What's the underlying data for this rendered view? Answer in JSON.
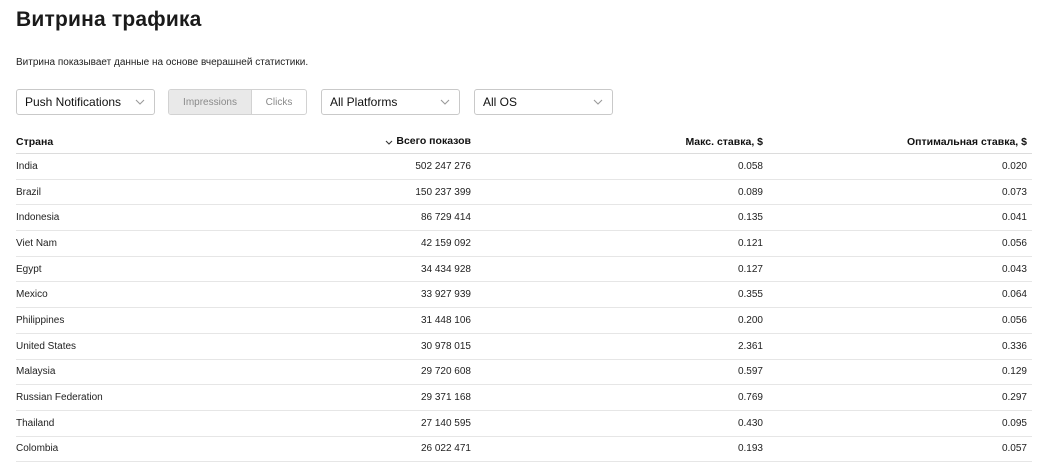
{
  "page": {
    "title": "Витрина трафика",
    "subtitle": "Витрина показывает данные на основе вчерашней статистики."
  },
  "filters": {
    "ad_format": {
      "selected": "Push Notifications"
    },
    "metric_toggle": {
      "options": [
        "Impressions",
        "Clicks"
      ],
      "active": "Impressions"
    },
    "platform": {
      "selected": "All Platforms"
    },
    "os": {
      "selected": "All OS"
    }
  },
  "table": {
    "columns": {
      "country": "Страна",
      "total": "Всего показов",
      "max_bid": "Макс. ставка, $",
      "optimal_bid": "Оптимальная ставка, $"
    },
    "sorted_by": "total",
    "rows": [
      {
        "country": "India",
        "total": "502 247 276",
        "max_bid": "0.058",
        "optimal_bid": "0.020"
      },
      {
        "country": "Brazil",
        "total": "150 237 399",
        "max_bid": "0.089",
        "optimal_bid": "0.073"
      },
      {
        "country": "Indonesia",
        "total": "86 729 414",
        "max_bid": "0.135",
        "optimal_bid": "0.041"
      },
      {
        "country": "Viet Nam",
        "total": "42 159 092",
        "max_bid": "0.121",
        "optimal_bid": "0.056"
      },
      {
        "country": "Egypt",
        "total": "34 434 928",
        "max_bid": "0.127",
        "optimal_bid": "0.043"
      },
      {
        "country": "Mexico",
        "total": "33 927 939",
        "max_bid": "0.355",
        "optimal_bid": "0.064"
      },
      {
        "country": "Philippines",
        "total": "31 448 106",
        "max_bid": "0.200",
        "optimal_bid": "0.056"
      },
      {
        "country": "United States",
        "total": "30 978 015",
        "max_bid": "2.361",
        "optimal_bid": "0.336"
      },
      {
        "country": "Malaysia",
        "total": "29 720 608",
        "max_bid": "0.597",
        "optimal_bid": "0.129"
      },
      {
        "country": "Russian Federation",
        "total": "29 371 168",
        "max_bid": "0.769",
        "optimal_bid": "0.297"
      },
      {
        "country": "Thailand",
        "total": "27 140 595",
        "max_bid": "0.430",
        "optimal_bid": "0.095"
      },
      {
        "country": "Colombia",
        "total": "26 022 471",
        "max_bid": "0.193",
        "optimal_bid": "0.057"
      }
    ]
  },
  "icons": {
    "dropdown": "chevron-down-icon",
    "sort": "sort-desc-icon"
  },
  "colors": {
    "border": "#c9c9c9",
    "toggle_active_bg": "#e9e9e9",
    "muted_text": "#8a8a8a",
    "row_divider": "#e6e6e6"
  }
}
